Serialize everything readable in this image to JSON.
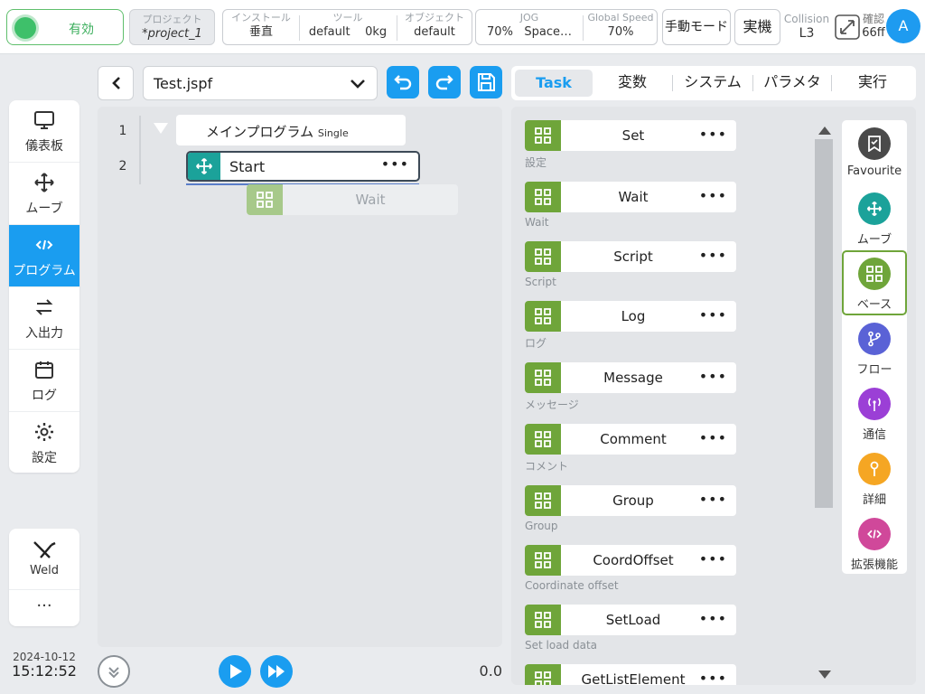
{
  "topbar": {
    "enable_label": "有効",
    "project": {
      "label": "プロジェクト",
      "value": "*project_1"
    },
    "install": {
      "label": "インストール",
      "value": "垂直"
    },
    "tool": {
      "label": "ツール",
      "value_name": "default",
      "value_load": "0kg"
    },
    "object": {
      "label": "オブジェクト",
      "value": "default"
    },
    "jog": {
      "label": "JOG",
      "value_speed": "70%",
      "value_space": "Space…"
    },
    "global_speed": {
      "label": "Global Speed",
      "value": "70%"
    },
    "mode_button": "手動モード",
    "real_button": "実機",
    "collision": {
      "label": "Collision",
      "value": "L3"
    },
    "confirm": {
      "label": "確認",
      "value": "66ff"
    },
    "avatar": "A"
  },
  "nav": {
    "items": [
      {
        "label": "儀表板",
        "icon": "monitor-icon"
      },
      {
        "label": "ムーブ",
        "icon": "move-icon"
      },
      {
        "label": "プログラム",
        "icon": "code-icon"
      },
      {
        "label": "入出力",
        "icon": "swap-icon"
      },
      {
        "label": "ログ",
        "icon": "calendar-icon"
      },
      {
        "label": "設定",
        "icon": "gear-icon"
      }
    ],
    "weld_label": "Weld",
    "more_label": "···",
    "date": "2024-10-12",
    "time": "15:12:52"
  },
  "program": {
    "file_name": "Test.jspf",
    "line_numbers": [
      "1",
      "2"
    ],
    "main_node": {
      "title": "メインプログラム",
      "mode": "Single"
    },
    "start_node": "Start",
    "ghost_node": "Wait",
    "speed": "0.0"
  },
  "tabs": [
    "Task",
    "変数",
    "システム",
    "パラメタ",
    "実行"
  ],
  "nodes": [
    {
      "name": "Set",
      "sub": "設定"
    },
    {
      "name": "Wait",
      "sub": "Wait"
    },
    {
      "name": "Script",
      "sub": "Script"
    },
    {
      "name": "Log",
      "sub": "ログ"
    },
    {
      "name": "Message",
      "sub": "メッセージ"
    },
    {
      "name": "Comment",
      "sub": "コメント"
    },
    {
      "name": "Group",
      "sub": "Group"
    },
    {
      "name": "CoordOffset",
      "sub": "Coordinate offset"
    },
    {
      "name": "SetLoad",
      "sub": "Set load data"
    },
    {
      "name": "GetListElement",
      "sub": ""
    }
  ],
  "categories": [
    {
      "label": "Favourite",
      "color": "#4a4a4a",
      "icon": "bookmark-icon"
    },
    {
      "label": "ムーブ",
      "color": "#1ba29a",
      "icon": "move-icon"
    },
    {
      "label": "ベース",
      "color": "#6fa53a",
      "icon": "grid-icon"
    },
    {
      "label": "フロー",
      "color": "#5a62d6",
      "icon": "branch-icon"
    },
    {
      "label": "通信",
      "color": "#9b3fd6",
      "icon": "antenna-icon"
    },
    {
      "label": "詳細",
      "color": "#f5a623",
      "icon": "wrench-icon"
    },
    {
      "label": "拡張機能",
      "color": "#d0489a",
      "icon": "code-icon"
    }
  ],
  "colors": {
    "accent": "#1a9df0",
    "base_green": "#6fa53a",
    "move_teal": "#1ba29a",
    "enable_green": "#3ec06a"
  }
}
